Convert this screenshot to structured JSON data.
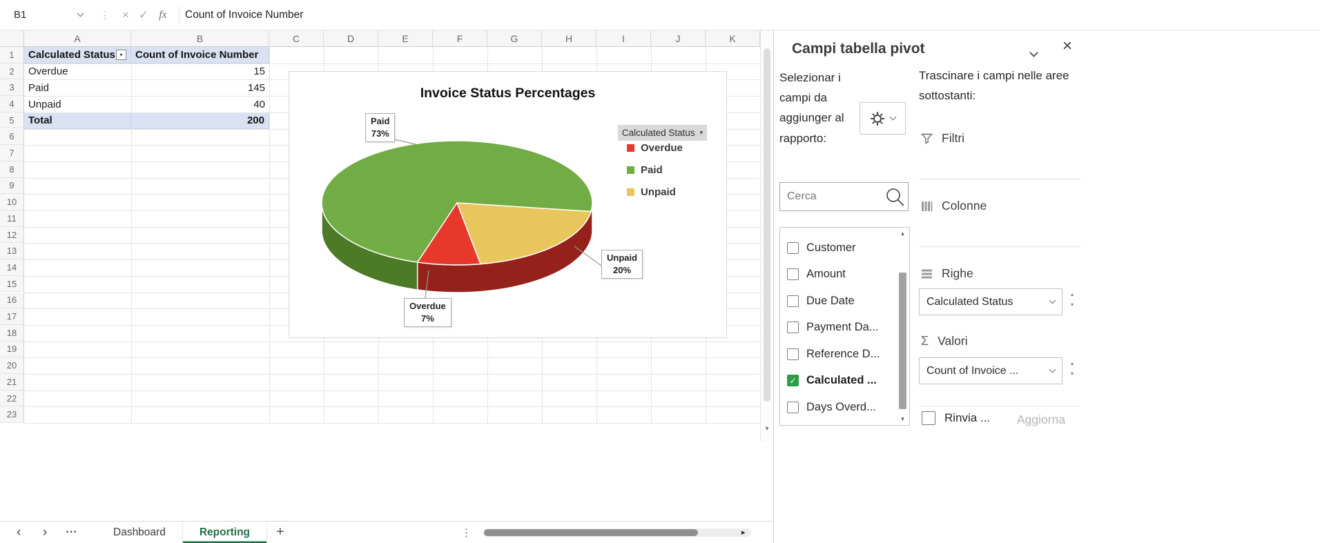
{
  "colors": {
    "accent_green": "#1E7145",
    "header_fill": "#D9E1F2",
    "checkbox_green": "#2E9E44"
  },
  "formula_bar": {
    "name_box": "B1",
    "formula": "Count of Invoice Number"
  },
  "grid": {
    "column_headers": [
      "A",
      "B",
      "C",
      "D",
      "E",
      "F",
      "G",
      "H",
      "I",
      "J",
      "K"
    ],
    "row_headers": [
      "1",
      "2",
      "3",
      "4",
      "5",
      "6",
      "7",
      "8",
      "9",
      "10",
      "11",
      "12",
      "13",
      "14",
      "15",
      "16",
      "17",
      "18",
      "19",
      "20",
      "21",
      "22",
      "23"
    ],
    "cells": [
      {
        "ref": "A1",
        "text": "Calculated Status",
        "style": "header",
        "filter": true
      },
      {
        "ref": "B1",
        "text": "Count of Invoice Number",
        "style": "header"
      },
      {
        "ref": "A2",
        "text": "Overdue"
      },
      {
        "ref": "B2",
        "text": "15",
        "align": "right"
      },
      {
        "ref": "A3",
        "text": "Paid"
      },
      {
        "ref": "B3",
        "text": "145",
        "align": "right"
      },
      {
        "ref": "A4",
        "text": "Unpaid"
      },
      {
        "ref": "B4",
        "text": "40",
        "align": "right"
      },
      {
        "ref": "A5",
        "text": "Total",
        "style": "total"
      },
      {
        "ref": "B5",
        "text": "200",
        "style": "total",
        "align": "right"
      }
    ]
  },
  "chart_data": {
    "type": "pie",
    "style": "3d-pie",
    "title": "Invoice Status Percentages",
    "legend_title": "Calculated Status",
    "legend_position": "right",
    "categories": [
      "Overdue",
      "Paid",
      "Unpaid"
    ],
    "values": [
      15,
      145,
      40
    ],
    "percents": [
      "7%",
      "73%",
      "20%"
    ],
    "colors": [
      "#E6392C",
      "#72AC44",
      "#E8C65C"
    ],
    "side_colors": [
      "#96211A",
      "#4C7A26",
      "#6F5E25"
    ],
    "callouts": [
      {
        "name": "Overdue",
        "pct": "7%"
      },
      {
        "name": "Paid",
        "pct": "73%"
      },
      {
        "name": "Unpaid",
        "pct": "20%"
      }
    ]
  },
  "pivot_pane": {
    "title": "Campi tabella pivot",
    "select_text": "Selezionar i campi da aggiunger al rapporto:",
    "drag_text": "Trascinare i campi nelle aree sottostanti:",
    "search_placeholder": "Cerca",
    "fields": [
      {
        "label": "Customer",
        "checked": false
      },
      {
        "label": "Amount",
        "checked": false
      },
      {
        "label": "Due Date",
        "checked": false
      },
      {
        "label": "Payment Da...",
        "checked": false
      },
      {
        "label": "Reference D...",
        "checked": false
      },
      {
        "label": "Calculated ...",
        "checked": true
      },
      {
        "label": "Days Overd...",
        "checked": false
      }
    ],
    "areas": {
      "filters_label": "Filtri",
      "columns_label": "Colonne",
      "rows_label": "Righe",
      "rows_value": "Calculated Status",
      "values_label": "Valori",
      "values_value": "Count of Invoice ..."
    },
    "defer_label": "Rinvia ...",
    "update_button": "Aggiorna"
  },
  "sheet_tabs": {
    "tabs": [
      {
        "label": "Dashboard"
      },
      {
        "label": "Reporting"
      }
    ],
    "active": "Reporting"
  },
  "icons": {
    "cancel": "×",
    "enter": "✓",
    "insert_function": "fx",
    "kebab": "⋮",
    "close": "×",
    "dropdown": "▾",
    "spin_up": "▴",
    "spin_down": "▾",
    "scroll_up": "▴",
    "scroll_down": "▾",
    "scroll_right": "▸",
    "tab_prev": "‹",
    "tab_next": "›",
    "tab_more": "•••",
    "new_sheet": "+",
    "sigma": "Σ"
  }
}
